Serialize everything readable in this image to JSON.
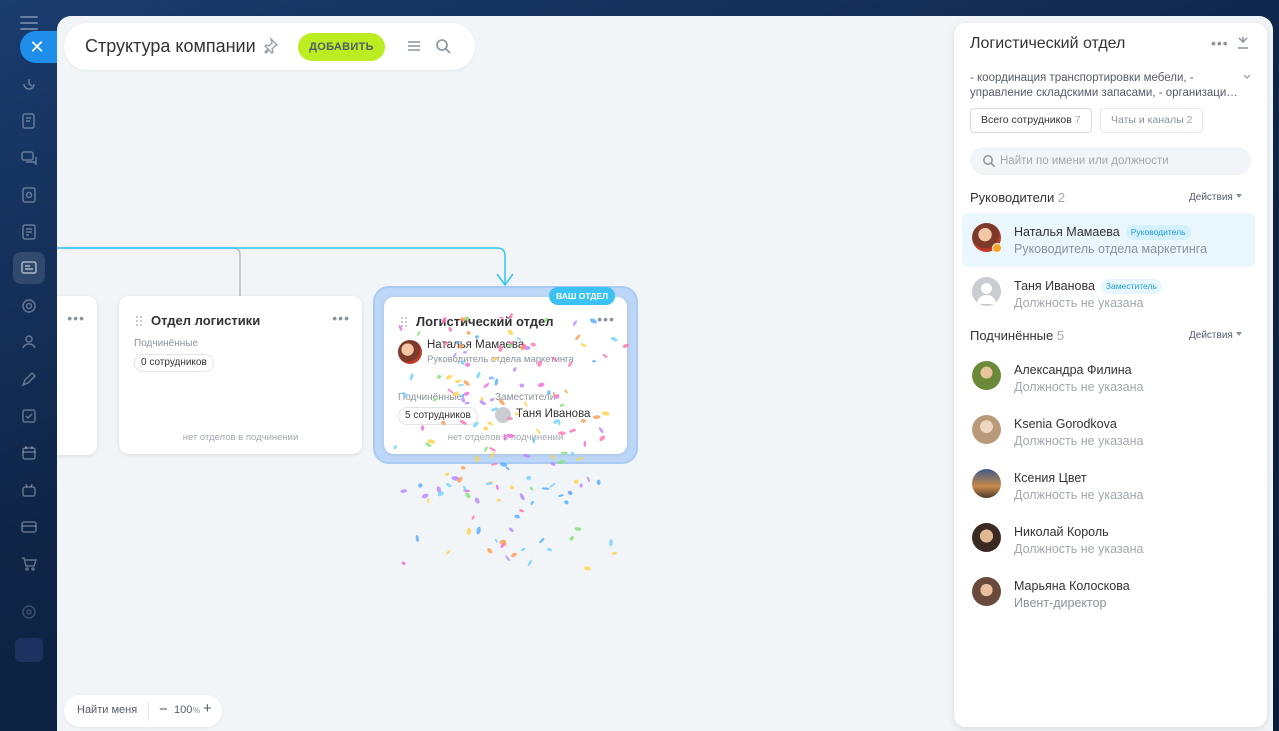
{
  "topbar": {
    "title": "Структура компании",
    "add_label": "ДОБАВИТЬ"
  },
  "cards": {
    "left_cut": {
      "dots": "•••"
    },
    "logistics_1": {
      "title": "Отдел логистики",
      "subordinates_label": "Подчинённые",
      "subordinates_count": "0 сотрудников",
      "footer": "нет отделов в подчинении"
    },
    "logistics_2": {
      "badge": "ВАШ ОТДЕЛ",
      "title": "Логистический отдел",
      "head_name": "Наталья Мамаева",
      "head_position": "Руководитель отдела маркетинга",
      "subordinates_label": "Подчинённые",
      "subordinates_count": "5 сотрудников",
      "deputies_label": "Заместители",
      "deputy_name": "Таня Иванова",
      "footer": "нет отделов в подчинении"
    }
  },
  "zoombar": {
    "find_me": "Найти меня",
    "minus": "−",
    "zoom": "100",
    "unit": "%",
    "plus": "+"
  },
  "panel": {
    "title": "Логистический отдел",
    "description": "- координация транспортировки мебели, -\nуправление складскими запасами, - организаци…",
    "tabs": [
      {
        "label": "Всего сотрудников",
        "count": "7"
      },
      {
        "label": "Чаты и каналы",
        "count": "2"
      }
    ],
    "search_placeholder": "Найти по имени или должности",
    "heads_section": {
      "title": "Руководители",
      "count": "2",
      "actions": "Действия"
    },
    "heads": [
      {
        "name": "Наталья Мамаева",
        "role": "Руководитель",
        "position": "Руководитель отдела маркетинга"
      },
      {
        "name": "Таня Иванова",
        "role": "Заместитель",
        "position": "Должность не указана"
      }
    ],
    "subs_section": {
      "title": "Подчинённые",
      "count": "5",
      "actions": "Действия"
    },
    "subs": [
      {
        "name": "Александра Филина",
        "position": "Должность не указана"
      },
      {
        "name": "Ksenia Gorodkova",
        "position": "Должность не указана"
      },
      {
        "name": "Ксения Цвет",
        "position": "Должность не указана"
      },
      {
        "name": "Николай Король",
        "position": "Должность не указана"
      },
      {
        "name": "Марьяна Колоскова",
        "position": "Ивент-директор"
      }
    ]
  },
  "colors": {
    "accent_green": "#bbed21",
    "accent_blue": "#3cc1f4",
    "rail_close": "#1e8eea",
    "connector_blue": "#2fc6f6"
  }
}
